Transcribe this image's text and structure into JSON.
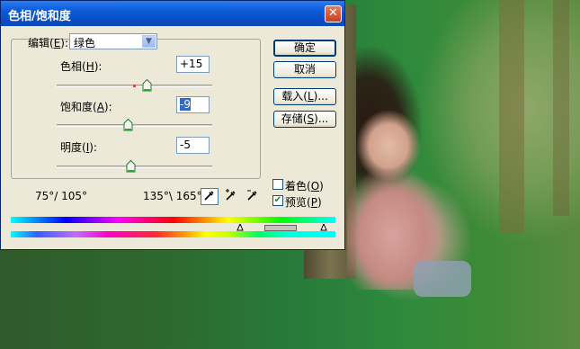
{
  "dialog": {
    "title": "色相/饱和度"
  },
  "edit": {
    "label": "编辑",
    "key": "E",
    "value": "绿色"
  },
  "hue": {
    "label": "色相",
    "key": "H",
    "value": "+15"
  },
  "saturation": {
    "label": "饱和度",
    "key": "A",
    "value": "-9"
  },
  "lightness": {
    "label": "明度",
    "key": "I",
    "value": "-5"
  },
  "buttons": {
    "ok": "确定",
    "cancel": "取消",
    "load": "载入",
    "load_key": "L",
    "save": "存储",
    "save_key": "S",
    "ellipsis": "..."
  },
  "options": {
    "colorize": "着色",
    "colorize_key": "O",
    "colorize_checked": false,
    "preview": "预览",
    "preview_key": "P",
    "preview_checked": true
  },
  "range": {
    "left": "75°/ 105°",
    "right": "135°\\ 165°"
  },
  "icons": [
    "eyedropper-icon",
    "eyedropper-plus-icon",
    "eyedropper-minus-icon"
  ]
}
